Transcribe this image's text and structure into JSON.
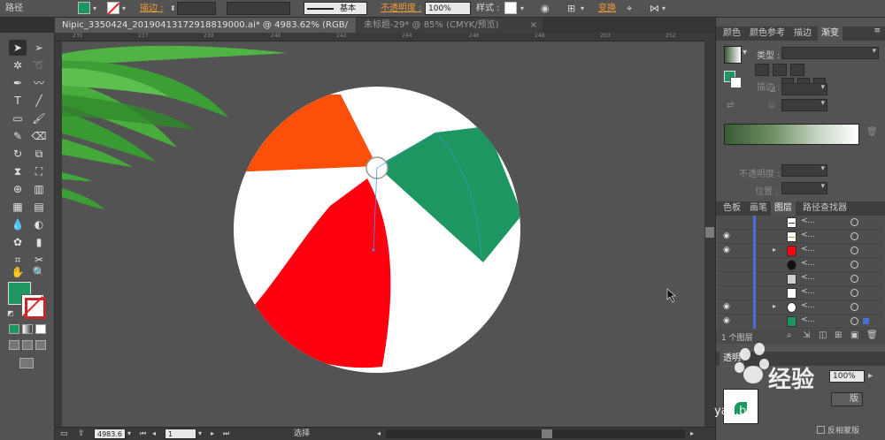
{
  "control_bar": {
    "object_type": "路径",
    "stroke_label": "描边 :",
    "stroke_style": "基本",
    "opacity_label": "不透明度 :",
    "opacity_value": "100%",
    "style_label": "样式 :",
    "transform_label": "变换",
    "fill_color": "#1d9661"
  },
  "tabs": [
    {
      "label": "Nipic_3350424_20190413172918819000.ai* @ 4983.62% (RGB/预览)",
      "active": true
    },
    {
      "label": "未标题-29* @ 85% (CMYK/预览)",
      "active": false
    }
  ],
  "ruler": {
    "marks": [
      "235",
      "237",
      "239",
      "240",
      "242",
      "244",
      "246",
      "248",
      "250",
      "252"
    ]
  },
  "status_bar": {
    "zoom": "4983.6",
    "artboard": "1",
    "tool": "选择"
  },
  "panels": {
    "top_tabs": [
      "颜色",
      "颜色参考",
      "描边",
      "渐变"
    ],
    "gradient": {
      "type_label": "类型 :",
      "stroke_label": "描边 :",
      "opacity_label": "不透明度 :",
      "position_label": "位置 :"
    },
    "layer_tabs": [
      "色板",
      "画笔",
      "图层",
      "路径查找器"
    ],
    "layers": [
      {
        "name": "<...",
        "eye": false,
        "expand": false,
        "thumb": "line"
      },
      {
        "name": "<...",
        "eye": true,
        "expand": false,
        "thumb": "line"
      },
      {
        "name": "<...",
        "eye": true,
        "expand": true,
        "thumb": "red"
      },
      {
        "name": "<...",
        "eye": false,
        "expand": false,
        "thumb": "black"
      },
      {
        "name": "<...",
        "eye": false,
        "expand": false,
        "thumb": "gray"
      },
      {
        "name": "<...",
        "eye": false,
        "expand": false,
        "thumb": "white"
      },
      {
        "name": "<...",
        "eye": true,
        "expand": true,
        "thumb": "white"
      },
      {
        "name": "<...",
        "eye": true,
        "expand": false,
        "thumb": "green"
      }
    ],
    "layer_count": "1 个图层",
    "transparency_tab": "透明",
    "transparency_value": "100%",
    "mask_button": "版",
    "clip_label": "反相蒙版"
  },
  "watermark": {
    "text": "经验",
    "url": "yan.b"
  },
  "colors": {
    "green": "#1d9661",
    "orange": "#fb4f0a",
    "red": "#fe0010",
    "leaf": "#3fa83a"
  }
}
